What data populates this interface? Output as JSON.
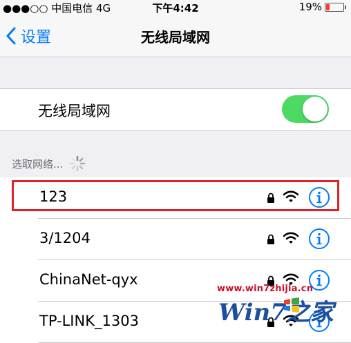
{
  "status_bar": {
    "carrier": "●●●○○ 中国电信 4G",
    "time": "下午4:42",
    "battery": "19%",
    "battery_level": 0.19,
    "battery_color": "#ff3b30"
  },
  "nav": {
    "back_label": "设置",
    "title": "无线局域网"
  },
  "wifi_toggle": {
    "label": "无线局域网",
    "on": true,
    "on_color": "#4cd964"
  },
  "section": {
    "choose_label": "选取网络..."
  },
  "networks": [
    {
      "name": "123",
      "secured": true,
      "highlighted": true
    },
    {
      "name": "3/1204",
      "secured": true
    },
    {
      "name": "ChinaNet-qyx",
      "secured": true
    },
    {
      "name": "TP-LINK_1303",
      "secured": true
    }
  ],
  "watermark": {
    "url": "www.win7zhijia.cn",
    "text": "Win7之家"
  },
  "icons": [
    "chevron-left-icon",
    "spinner-icon",
    "lock-icon",
    "wifi-icon",
    "info-icon",
    "battery-icon",
    "windows-logo-icon"
  ],
  "accent_color": "#007aff",
  "highlight_color": "#e0222a"
}
